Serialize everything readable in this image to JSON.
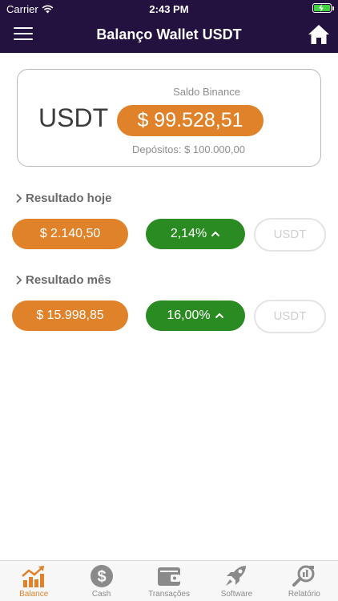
{
  "status": {
    "carrier": "Carrier",
    "time": "2:43 PM"
  },
  "nav": {
    "title": "Balanço Wallet USDT"
  },
  "card": {
    "label": "Saldo Binance",
    "currency": "USDT",
    "amount": "$ 99.528,51",
    "deposits": "Depósitos: $ 100.000,00"
  },
  "today": {
    "title": "Resultado hoje",
    "amount": "$ 2.140,50",
    "percent": "2,14%",
    "unit": "USDT"
  },
  "month": {
    "title": "Resultado mês",
    "amount": "$ 15.998,85",
    "percent": "16,00%",
    "unit": "USDT"
  },
  "tabs": [
    {
      "label": "Balance",
      "icon": "chart-up-icon"
    },
    {
      "label": "Cash",
      "icon": "dollar-coin-icon"
    },
    {
      "label": "Transações",
      "icon": "wallet-icon"
    },
    {
      "label": "Software",
      "icon": "rocket-icon"
    },
    {
      "label": "Relatório",
      "icon": "report-search-icon"
    }
  ],
  "colors": {
    "navbar": "#23123f",
    "accent": "#e0822a",
    "positive": "#2a8b22"
  }
}
